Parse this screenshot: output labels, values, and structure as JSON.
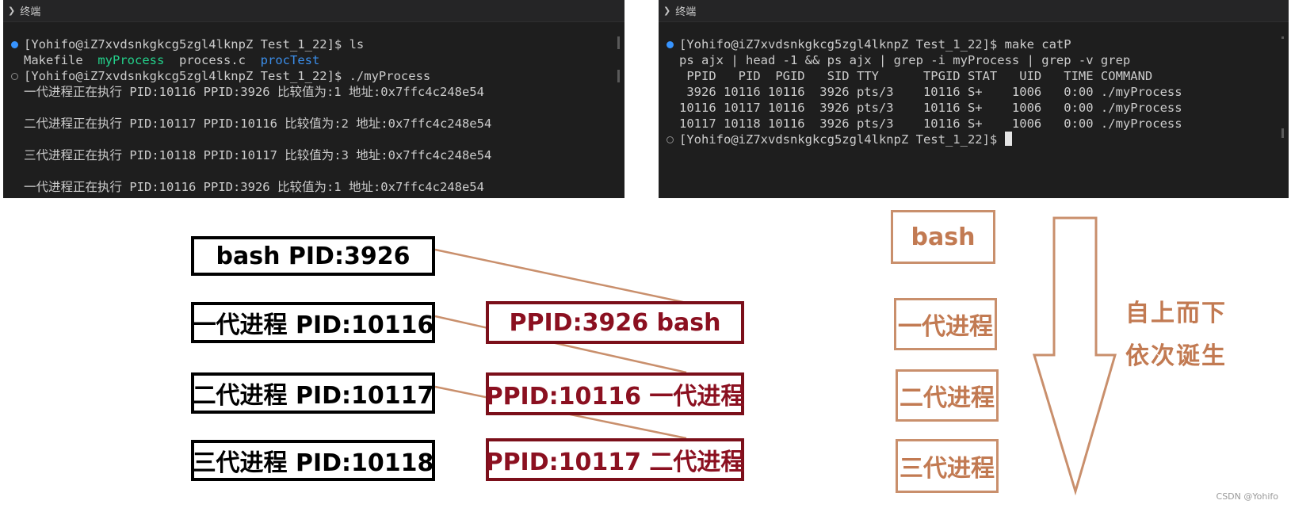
{
  "left_terminal": {
    "title": "终端",
    "lines": [
      {
        "marker": "dot",
        "segments": [
          {
            "text": "[Yohifo@iZ7xvdsnkgkcg5zgl4lknpZ Test_1_22]$ ls",
            "color": "default"
          }
        ]
      },
      {
        "marker": "none",
        "segments": [
          {
            "text": "Makefile  ",
            "color": "default"
          },
          {
            "text": "myProcess",
            "color": "green"
          },
          {
            "text": "  process.c  ",
            "color": "default"
          },
          {
            "text": "procTest",
            "color": "blue"
          }
        ]
      },
      {
        "marker": "ring",
        "segments": [
          {
            "text": "[Yohifo@iZ7xvdsnkgkcg5zgl4lknpZ Test_1_22]$ ./myProcess",
            "color": "default"
          }
        ]
      },
      {
        "marker": "none",
        "segments": [
          {
            "text": "一代进程正在执行 PID:10116 PPID:3926 比较值为:1 地址:0x7ffc4c248e54",
            "color": "default"
          }
        ]
      },
      {
        "marker": "none",
        "segments": [
          {
            "text": "",
            "color": "default"
          }
        ]
      },
      {
        "marker": "none",
        "segments": [
          {
            "text": "二代进程正在执行 PID:10117 PPID:10116 比较值为:2 地址:0x7ffc4c248e54",
            "color": "default"
          }
        ]
      },
      {
        "marker": "none",
        "segments": [
          {
            "text": "",
            "color": "default"
          }
        ]
      },
      {
        "marker": "none",
        "segments": [
          {
            "text": "三代进程正在执行 PID:10118 PPID:10117 比较值为:3 地址:0x7ffc4c248e54",
            "color": "default"
          }
        ]
      },
      {
        "marker": "none",
        "segments": [
          {
            "text": "",
            "color": "default"
          }
        ]
      },
      {
        "marker": "none",
        "segments": [
          {
            "text": "一代进程正在执行 PID:10116 PPID:3926 比较值为:1 地址:0x7ffc4c248e54",
            "color": "default"
          }
        ]
      }
    ]
  },
  "right_terminal": {
    "title": "终端",
    "lines": [
      {
        "marker": "dot",
        "segments": [
          {
            "text": "[Yohifo@iZ7xvdsnkgkcg5zgl4lknpZ Test_1_22]$ make catP",
            "color": "default"
          }
        ]
      },
      {
        "marker": "none",
        "segments": [
          {
            "text": "ps ajx | head -1 && ps ajx | grep -i myProcess | grep -v grep",
            "color": "default"
          }
        ]
      },
      {
        "marker": "none",
        "segments": [
          {
            "text": " PPID   PID  PGID   SID TTY      TPGID STAT   UID   TIME COMMAND",
            "color": "default"
          }
        ]
      },
      {
        "marker": "none",
        "segments": [
          {
            "text": " 3926 10116 10116  3926 pts/3    10116 S+    1006   0:00 ./myProcess",
            "color": "default"
          }
        ]
      },
      {
        "marker": "none",
        "segments": [
          {
            "text": "10116 10117 10116  3926 pts/3    10116 S+    1006   0:00 ./myProcess",
            "color": "default"
          }
        ]
      },
      {
        "marker": "none",
        "segments": [
          {
            "text": "10117 10118 10116  3926 pts/3    10116 S+    1006   0:00 ./myProcess",
            "color": "default"
          }
        ]
      },
      {
        "marker": "ring",
        "segments": [
          {
            "text": "[Yohifo@iZ7xvdsnkgkcg5zgl4lknpZ Test_1_22]$ ",
            "color": "default"
          }
        ],
        "cursor": true
      }
    ]
  },
  "diagram": {
    "pid_boxes": [
      "bash PID:3926",
      "一代进程 PID:10116",
      "二代进程 PID:10117",
      "三代进程 PID:10118"
    ],
    "ppid_boxes": [
      "PPID:3926 bash",
      "PPID:10116 一代进程",
      "PPID:10117 二代进程"
    ],
    "generation_boxes": [
      "bash",
      "一代进程",
      "二代进程",
      "三代进程"
    ],
    "arrow_caption": [
      "自上而下",
      "依次诞生"
    ],
    "connector_color": "#c98f6c",
    "pid_border_color": "#000000",
    "ppid_border_color": "#7b0f1a",
    "generation_color": "#c27a52"
  },
  "watermark": "CSDN @Yohifo"
}
